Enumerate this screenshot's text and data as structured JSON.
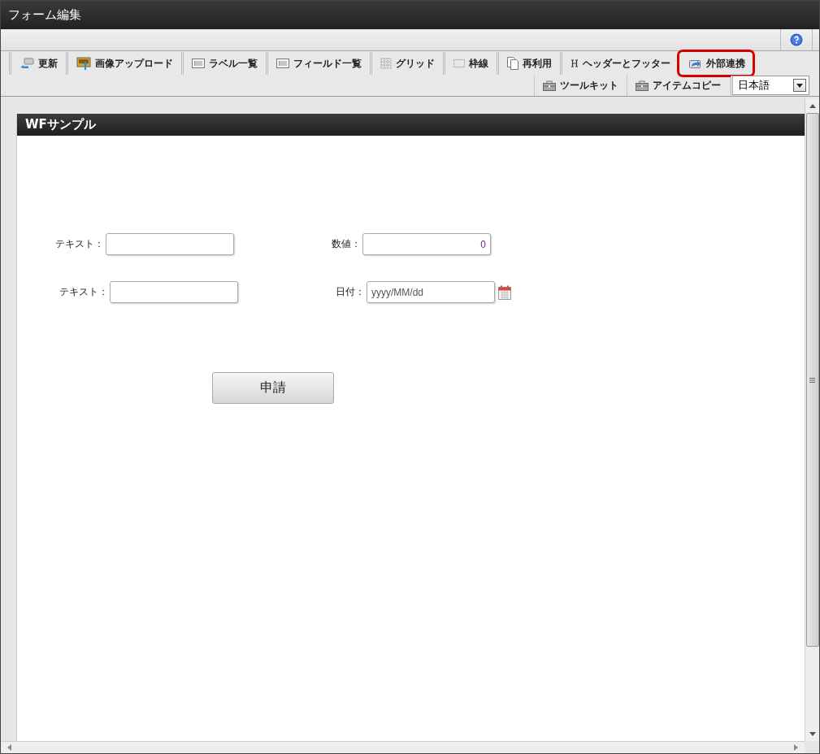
{
  "window": {
    "title": "フォーム編集"
  },
  "toolbar_row_1": [
    {
      "label": "更新",
      "kind": "arrow",
      "highlighted": false
    },
    {
      "label": "画像アップロード",
      "kind": "image",
      "highlighted": false
    },
    {
      "label": "ラベル一覧",
      "kind": "list",
      "highlighted": false
    },
    {
      "label": "フィールド一覧",
      "kind": "list",
      "highlighted": false
    },
    {
      "label": "グリッド",
      "kind": "grid",
      "highlighted": false
    },
    {
      "label": "枠線",
      "kind": "frame",
      "highlighted": false
    },
    {
      "label": "再利用",
      "kind": "pages",
      "highlighted": false
    },
    {
      "label": "ヘッダーとフッター",
      "kind": "letter",
      "highlighted": false
    },
    {
      "label": "外部連携",
      "kind": "share",
      "highlighted": true
    }
  ],
  "toolbar_row_2": [
    {
      "label": "ツールキット",
      "kind": "toolbox"
    },
    {
      "label": "アイテムコピー",
      "kind": "toolbox"
    }
  ],
  "language_select": {
    "value": "日本語"
  },
  "form": {
    "title": "WFサンプル",
    "fields": [
      {
        "label": "テキスト：",
        "kind": "text"
      },
      {
        "label": "数値：",
        "kind": "number",
        "value": "0"
      },
      {
        "label": "テキスト：",
        "kind": "text"
      },
      {
        "label": "日付：",
        "kind": "date",
        "placeholder": "yyyy/MM/dd"
      }
    ],
    "submit_button": "申請"
  }
}
